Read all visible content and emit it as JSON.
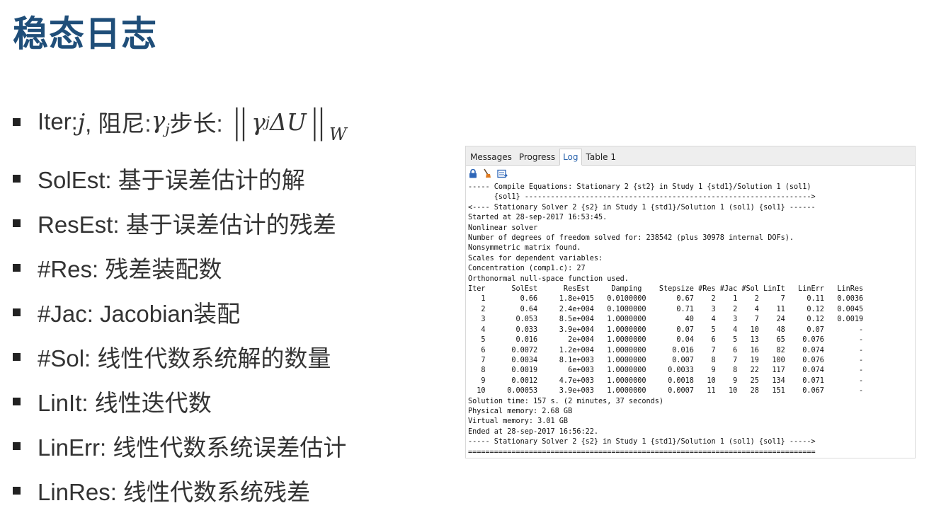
{
  "slide": {
    "title": "稳态日志"
  },
  "bullets": [
    {
      "kind": "math",
      "pre_iter": "Iter: ",
      "iter_var": "j",
      "mid_damping": ", 阻尼: ",
      "gamma": "γ",
      "sub_j": "j",
      "step_label": " 步长: ",
      "norm_expr": "γ",
      "norm_sub": "j",
      "norm_rest": "ΔU",
      "norm_w": "W"
    },
    {
      "kind": "text",
      "text": "SolEst: 基于误差估计的解"
    },
    {
      "kind": "text",
      "text": "ResEst: 基于误差估计的残差"
    },
    {
      "kind": "text",
      "text": "#Res: 残差装配数"
    },
    {
      "kind": "text",
      "text": "#Jac: Jacobian装配"
    },
    {
      "kind": "text",
      "text": "#Sol: 线性代数系统解的数量"
    },
    {
      "kind": "text",
      "text": "LinIt: 线性迭代数"
    },
    {
      "kind": "text",
      "text": "LinErr: 线性代数系统误差估计"
    },
    {
      "kind": "text",
      "text": "LinRes: 线性代数系统残差"
    }
  ],
  "panel": {
    "tabs": [
      "Messages",
      "Progress",
      "Log",
      "Table 1"
    ],
    "active_tab": "Log",
    "toolbar_icons": [
      "lock-icon",
      "clear-brush-icon",
      "export-icon"
    ],
    "log_lines": [
      "----- Compile Equations: Stationary 2 {st2} in Study 1 {std1}/Solution 1 (sol1)",
      "      {sol1} ------------------------------------------------------------------>",
      "<---- Stationary Solver 2 {s2} in Study 1 {std1}/Solution 1 (sol1) {sol1} ------",
      "Started at 28-sep-2017 16:53:45.",
      "Nonlinear solver",
      "Number of degrees of freedom solved for: 238542 (plus 30978 internal DOFs).",
      "Nonsymmetric matrix found.",
      "Scales for dependent variables:",
      "Concentration (comp1.c): 27",
      "Orthonormal null-space function used.",
      "Iter      SolEst      ResEst     Damping    Stepsize #Res #Jac #Sol LinIt   LinErr   LinRes",
      "   1        0.66     1.8e+015   0.0100000       0.67    2    1    2     7     0.11   0.0036",
      "   2        0.64     2.4e+004   0.1000000       0.71    3    2    4    11     0.12   0.0045",
      "   3       0.053     8.5e+004   1.0000000         40    4    3    7    24     0.12   0.0019",
      "   4       0.033     3.9e+004   1.0000000       0.07    5    4   10    48     0.07        -",
      "   5       0.016       2e+004   1.0000000       0.04    6    5   13    65    0.076        -",
      "   6      0.0072     1.2e+004   1.0000000      0.016    7    6   16    82    0.074        -",
      "   7      0.0034     8.1e+003   1.0000000      0.007    8    7   19   100    0.076        -",
      "   8      0.0019       6e+003   1.0000000     0.0033    9    8   22   117    0.074        -",
      "   9      0.0012     4.7e+003   1.0000000     0.0018   10    9   25   134    0.071        -",
      "  10     0.00053     3.9e+003   1.0000000     0.0007   11   10   28   151    0.067        -",
      "Solution time: 157 s. (2 minutes, 37 seconds)",
      "Physical memory: 2.68 GB",
      "Virtual memory: 3.01 GB",
      "Ended at 28-sep-2017 16:56:22.",
      "----- Stationary Solver 2 {s2} in Study 1 {std1}/Solution 1 (sol1) {sol1} ----->",
      "================================================================================"
    ]
  }
}
